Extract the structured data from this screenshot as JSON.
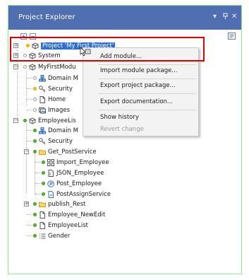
{
  "panel": {
    "title": "Project Explorer",
    "dropdown_glyph": "▾",
    "pin_glyph": "₽",
    "close_glyph": "✕"
  },
  "toolbar": {
    "expand_glyph": "+",
    "collapse_glyph": "−"
  },
  "tree": {
    "rows": [
      {
        "label": "Project 'My First Project'",
        "icon": "project-icon",
        "status": "yellow",
        "selected": true
      },
      {
        "label": "System",
        "icon": "system-icon",
        "status": "none"
      },
      {
        "label": "MyFirstModu",
        "icon": "module-icon",
        "status": "none"
      },
      {
        "label": "Domain M",
        "icon": "domain-model-icon",
        "status": "none"
      },
      {
        "label": "Security",
        "icon": "security-icon",
        "status": "yellow"
      },
      {
        "label": "Home",
        "icon": "page-icon",
        "status": "none"
      },
      {
        "label": "Images",
        "icon": "images-icon",
        "status": "none"
      },
      {
        "label": "EmployeeLis",
        "icon": "module-icon",
        "status": "green"
      },
      {
        "label": "Domain M",
        "icon": "domain-model-icon",
        "status": "green"
      },
      {
        "label": "Security",
        "icon": "security-icon",
        "status": "green"
      },
      {
        "label": "Get_PostService",
        "icon": "folder-icon",
        "status": "green"
      },
      {
        "label": "Import_Employee",
        "icon": "import-mapping-icon",
        "status": "green"
      },
      {
        "label": "JSON_Employee",
        "icon": "json-structure-icon",
        "status": "green"
      },
      {
        "label": "Post_Employee",
        "icon": "microflow-icon",
        "status": "green"
      },
      {
        "label": "PostAssignService",
        "icon": "nanoflow-icon",
        "status": "green"
      },
      {
        "label": "publish_Rest",
        "icon": "folder-icon",
        "status": "green"
      },
      {
        "label": "Employee_NewEdit",
        "icon": "page-icon",
        "status": "green"
      },
      {
        "label": "EmployeeList",
        "icon": "page-icon",
        "status": "green"
      },
      {
        "label": "Gender",
        "icon": "enumeration-icon",
        "status": "green"
      }
    ]
  },
  "context_menu": {
    "items": [
      {
        "label": "Add module...",
        "enabled": true
      },
      {
        "label": "Import module package...",
        "enabled": true
      },
      {
        "label": "Export project package...",
        "enabled": true
      },
      {
        "label": "Export documentation...",
        "enabled": true
      },
      {
        "label": "Show history",
        "enabled": true
      },
      {
        "label": "Revert change",
        "enabled": false
      }
    ]
  },
  "colors": {
    "title_bar": "#4f6fb0",
    "selection": "#2d6fd6",
    "highlight_box": "#e00000",
    "status_green": "#5cb833",
    "status_yellow": "#f1c51a"
  }
}
